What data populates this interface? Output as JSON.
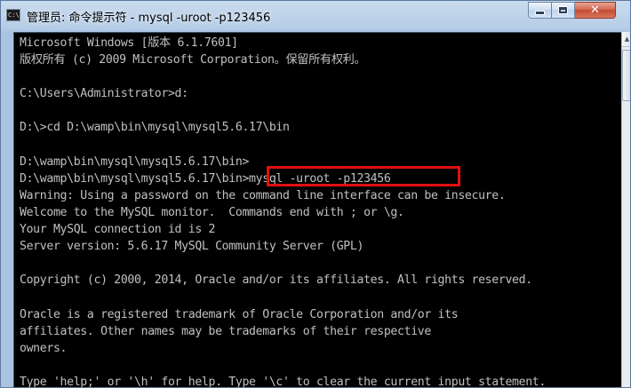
{
  "window": {
    "title": "管理员: 命令提示符 - mysql  -uroot -p123456",
    "icon": "command-prompt-icon",
    "icon_glyph": "C:\\",
    "controls": {
      "minimize_icon": "minimize-icon",
      "maximize_icon": "maximize-icon",
      "close_icon": "close-icon",
      "close_glyph": "✕"
    }
  },
  "console": {
    "background": "#000000",
    "foreground": "#c0c0c0",
    "highlight_color": "#e01010",
    "lines": [
      "Microsoft Windows [版本 6.1.7601]",
      "版权所有 (c) 2009 Microsoft Corporation。保留所有权利。",
      "",
      "C:\\Users\\Administrator>d:",
      "",
      "D:\\>cd D:\\wamp\\bin\\mysql\\mysql5.6.17\\bin",
      "",
      "D:\\wamp\\bin\\mysql\\mysql5.6.17\\bin>",
      "D:\\wamp\\bin\\mysql\\mysql5.6.17\\bin>mysql -uroot -p123456",
      "Warning: Using a password on the command line interface can be insecure.",
      "Welcome to the MySQL monitor.  Commands end with ; or \\g.",
      "Your MySQL connection id is 2",
      "Server version: 5.6.17 MySQL Community Server (GPL)",
      "",
      "Copyright (c) 2000, 2014, Oracle and/or its affiliates. All rights reserved.",
      "",
      "Oracle is a registered trademark of Oracle Corporation and/or its",
      "affiliates. Other names may be trademarks of their respective",
      "owners.",
      "",
      "Type 'help;' or '\\h' for help. Type '\\c' to clear the current input statement."
    ],
    "highlighted_command": "mysql -uroot -p123456"
  },
  "scrollbar": {
    "up_arrow_icon": "scroll-up-arrow-icon",
    "up_arrow_glyph": "▲"
  }
}
